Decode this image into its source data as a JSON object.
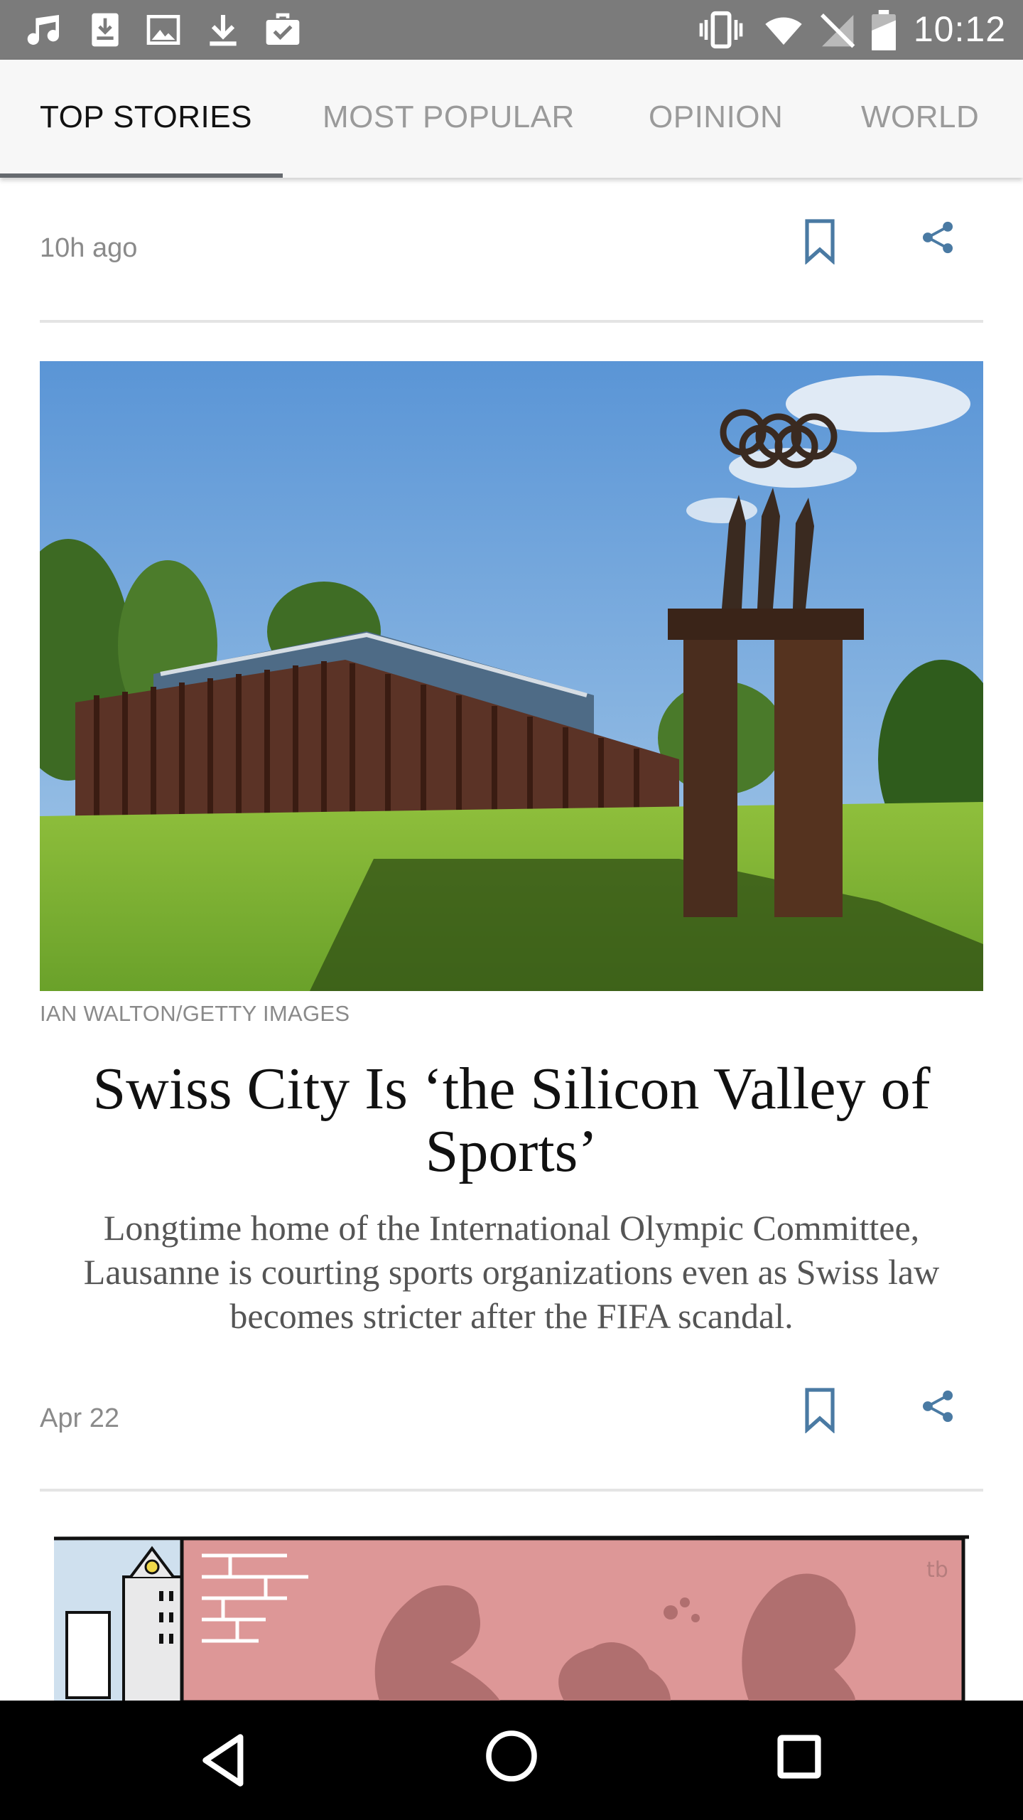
{
  "status_bar": {
    "time": "10:12",
    "left_icons": [
      "music-note-icon",
      "download-box-icon",
      "image-icon",
      "download-icon",
      "briefcase-check-icon"
    ],
    "right_icons": [
      "vibrate-icon",
      "wifi-icon",
      "no-signal-icon",
      "battery-icon"
    ]
  },
  "tabs": [
    {
      "label": "TOP STORIES",
      "active": true
    },
    {
      "label": "MOST POPULAR",
      "active": false
    },
    {
      "label": "OPINION",
      "active": false
    },
    {
      "label": "WORLD",
      "active": false
    }
  ],
  "articles": [
    {
      "time": "10h ago",
      "image_credit": "IAN WALTON/GETTY IMAGES",
      "headline": "Swiss City Is ‘the Silicon Valley of Sports’",
      "summary": "Longtime home of the International Olympic Committee, Lausanne is courting sports organizations even as Swiss law becomes stricter after the FIFA scandal."
    },
    {
      "time": "Apr 22",
      "cartoon_signature": "tb"
    }
  ],
  "colors": {
    "status_bar": "#7b7b7b",
    "tab_bar": "#f7f7f7",
    "tab_indicator": "#666a6f",
    "icon_blue": "#4a7aa3",
    "nav_bar": "#000000"
  },
  "nav_bar": {
    "buttons": [
      "back-icon",
      "home-icon",
      "recents-icon"
    ]
  }
}
